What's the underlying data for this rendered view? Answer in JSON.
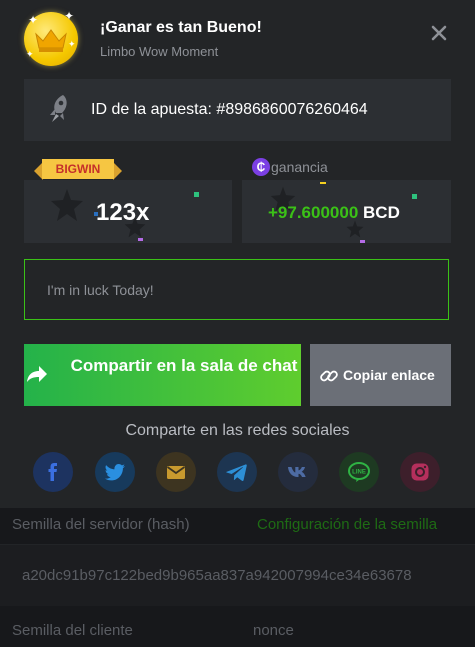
{
  "modal": {
    "title": "¡Ganar es tan Bueno!",
    "subtitle": "Limbo Wow Moment",
    "bet_id_label": "ID de la apuesta: #8986860076260464",
    "bigwin_badge": "BIGWIN",
    "multiplier": "123x",
    "gain_label": "ganancia",
    "profit_value": "+97.600000",
    "profit_currency": "BCD",
    "message_placeholder": "I'm in luck Today!",
    "share_button": "Compartir en la sala de chat",
    "copy_button": "Copiar enlace",
    "social_title": "Comparte en las redes sociales",
    "social_networks": [
      "facebook-icon",
      "twitter-icon",
      "email-icon",
      "telegram-icon",
      "vk-icon",
      "line-icon",
      "instagram-icon"
    ]
  },
  "background": {
    "server_seed_label": "Semilla del servidor (hash)",
    "seed_settings_link": "Configuración de la semilla",
    "server_seed_hash": "a20dc91b97c122bed9b965aa837a942007994ce34e63678",
    "client_seed_label": "Semilla del cliente",
    "client_seed_value": "nonce"
  },
  "colors": {
    "accent_green": "#3bc117",
    "modal_bg": "#232527",
    "panel_bg": "#2c2f33",
    "copy_button_bg": "#6b6f77",
    "bigwin_ribbon": "#f6c642",
    "coin_purple": "#7b3fe4"
  }
}
